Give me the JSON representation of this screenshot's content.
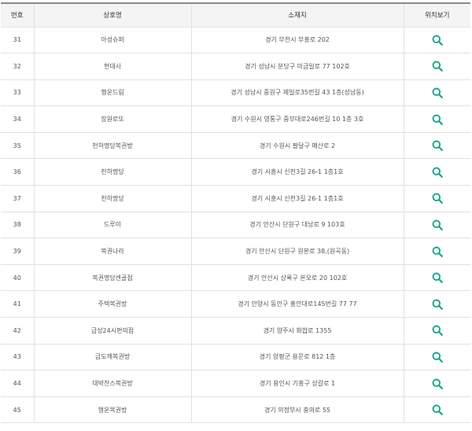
{
  "accent_color": "#1aa58e",
  "table": {
    "headers": {
      "number": "번호",
      "name": "상호명",
      "address": "소재지",
      "location": "위치보기"
    },
    "rows": [
      {
        "number": "31",
        "name": "아성슈퍼",
        "address": "경기 부천시 부흥로 202",
        "icon": "search-icon"
      },
      {
        "number": "32",
        "name": "현대사",
        "address": "경기 성남시 분당구 미금일로 77 102호",
        "icon": "search-icon"
      },
      {
        "number": "33",
        "name": "행운드림",
        "address": "경기 성남시 중원구 제일로35번길 43 1층(성남동)",
        "icon": "search-icon"
      },
      {
        "number": "34",
        "name": "장원로또",
        "address": "경기 수원시 영통구 중부대로246번길 10 1층 3호",
        "icon": "search-icon"
      },
      {
        "number": "35",
        "name": "천하명당복권방",
        "address": "경기 수원시 팔달구 매산로 2",
        "icon": "search-icon"
      },
      {
        "number": "36",
        "name": "천하명당",
        "address": "경기 시흥시 신천3길 26-1 1층1호",
        "icon": "search-icon"
      },
      {
        "number": "37",
        "name": "천하명당",
        "address": "경기 시흥시 신천3길 26-1 1층1호",
        "icon": "search-icon"
      },
      {
        "number": "38",
        "name": "드루이",
        "address": "경기 안산시 단원구 대남로 9 103호",
        "icon": "search-icon"
      },
      {
        "number": "39",
        "name": "복권나라",
        "address": "경기 안산시 단원구 원본로 38,(원곡동)",
        "icon": "search-icon"
      },
      {
        "number": "40",
        "name": "복권명당센골점",
        "address": "경기 안산시 상록구 본오로 20 102호",
        "icon": "search-icon"
      },
      {
        "number": "41",
        "name": "주택복권방",
        "address": "경기 안양시 동안구 홍안대로145번길 77 77",
        "icon": "search-icon"
      },
      {
        "number": "42",
        "name": "금성24시편의점",
        "address": "경기 양주시 화합로 1355",
        "icon": "search-icon"
      },
      {
        "number": "43",
        "name": "금도깨복권방",
        "address": "경기 양평군 용문로 812 1층",
        "icon": "search-icon"
      },
      {
        "number": "44",
        "name": "대박찬스복권방",
        "address": "경기 용인시 기흥구 상갈로 1",
        "icon": "search-icon"
      },
      {
        "number": "45",
        "name": "행운복권방",
        "address": "경기 의정부시 충의로 55",
        "icon": "search-icon"
      }
    ]
  }
}
